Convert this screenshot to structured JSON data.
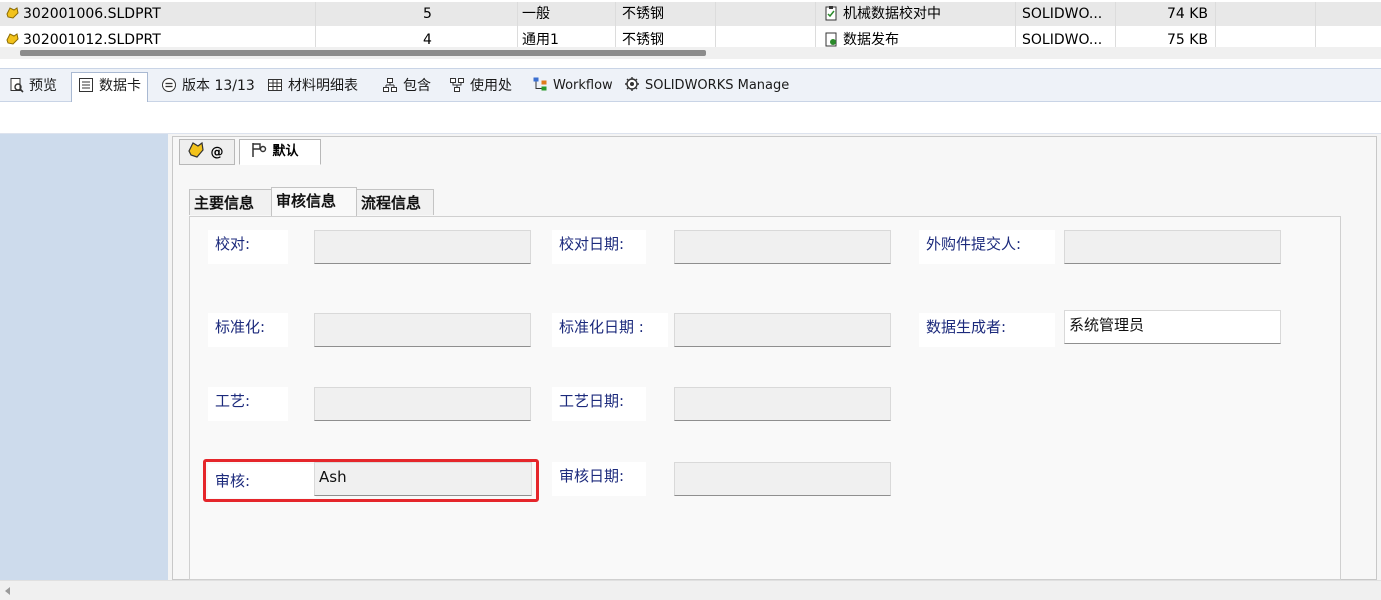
{
  "file_list": {
    "rows": [
      {
        "name": "302001006.SLDPRT",
        "revision": "5",
        "category": "一般",
        "material": "不锈钢",
        "state": "机械数据校对中",
        "app": "SOLIDWO...",
        "size": "74 KB"
      },
      {
        "name": "302001012.SLDPRT",
        "revision": "4",
        "category": "通用1",
        "material": "不锈钢",
        "state": "数据发布",
        "app": "SOLIDWO...",
        "size": "75 KB"
      }
    ]
  },
  "view_tabs": [
    {
      "label": "预览",
      "icon": "preview-icon"
    },
    {
      "label": "数据卡",
      "icon": "datacard-icon"
    },
    {
      "label": "版本 13/13",
      "icon": "version-icon"
    },
    {
      "label": "材料明细表",
      "icon": "bom-icon"
    },
    {
      "label": "包含",
      "icon": "contains-icon"
    },
    {
      "label": "使用处",
      "icon": "where-used-icon"
    },
    {
      "label": "Workflow",
      "icon": "workflow-icon"
    },
    {
      "label": "SOLIDWORKS Manage",
      "icon": "manage-icon"
    }
  ],
  "config_tabs": [
    {
      "label": "@",
      "icon": "part-icon"
    },
    {
      "label": "默认",
      "icon": "configuration-icon"
    }
  ],
  "form_tabs": [
    "主要信息",
    "审核信息",
    "流程信息"
  ],
  "form": {
    "proofread_label": "校对:",
    "proofread_value": "",
    "proofread_date_label": "校对日期:",
    "proofread_date_value": "",
    "purchase_submitter_label": "外购件提交人:",
    "purchase_submitter_value": "",
    "standardize_label": "标准化:",
    "standardize_value": "",
    "standardize_date_label": "标准化日期 :",
    "standardize_date_value": "",
    "data_creator_label": "数据生成者:",
    "data_creator_value": "系统管理员",
    "process_label": "工艺:",
    "process_value": "",
    "process_date_label": "工艺日期:",
    "process_date_value": "",
    "review_label": "审核:",
    "review_value": "Ash",
    "review_date_label": "审核日期:",
    "review_date_value": ""
  },
  "colors": {
    "accent_highlight": "#e5262b",
    "label_text": "#1c2a7c",
    "left_pane": "#cddbec"
  }
}
